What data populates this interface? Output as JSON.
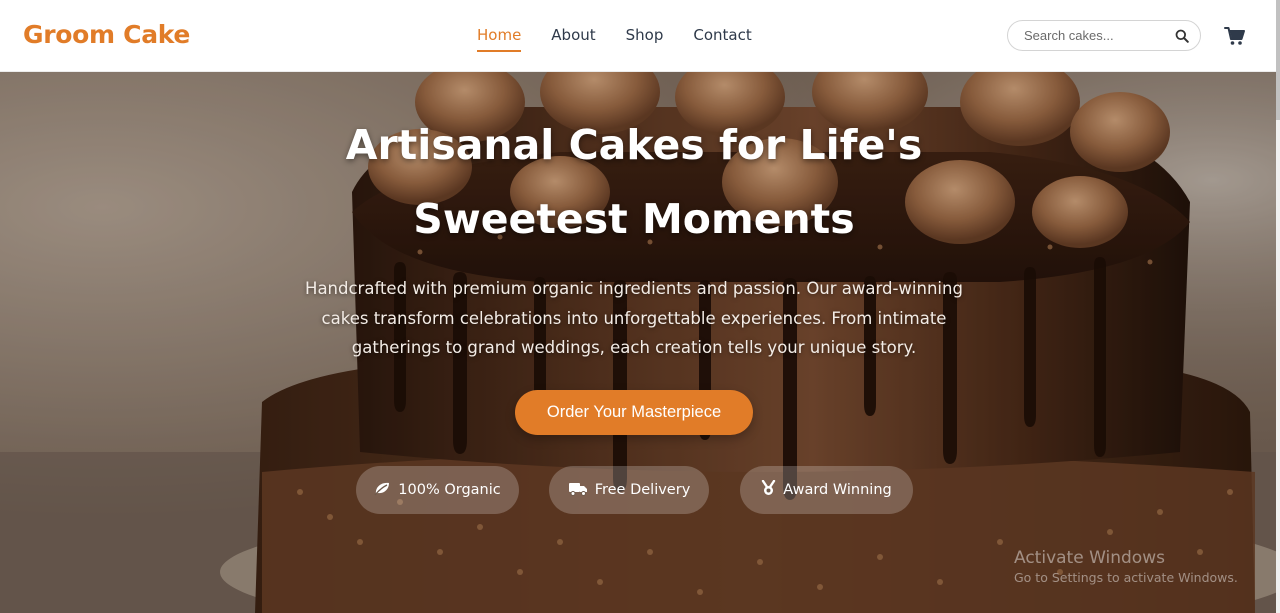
{
  "header": {
    "brand": "Groom Cake",
    "nav": [
      {
        "label": "Home",
        "active": true
      },
      {
        "label": "About",
        "active": false
      },
      {
        "label": "Shop",
        "active": false
      },
      {
        "label": "Contact",
        "active": false
      }
    ],
    "search": {
      "placeholder": "Search cakes...",
      "value": "",
      "icon": "search-icon"
    },
    "cart_icon": "cart-icon"
  },
  "hero": {
    "title_line1": "Artisanal Cakes for Life's",
    "title_line2": "Sweetest Moments",
    "description": "Handcrafted with premium organic ingredients and passion. Our award-winning cakes transform celebrations into unforgettable experiences. From intimate gatherings to grand weddings, each creation tells your unique story.",
    "cta_label": "Order Your Masterpiece",
    "badges": [
      {
        "label": "100% Organic",
        "icon": "leaf-icon"
      },
      {
        "label": "Free Delivery",
        "icon": "truck-icon"
      },
      {
        "label": "Award Winning",
        "icon": "medal-icon"
      }
    ]
  },
  "os_watermark": {
    "title": "Activate Windows",
    "subtitle": "Go to Settings to activate Windows."
  },
  "colors": {
    "accent": "#e17c28",
    "nav_text": "#2f3a4a",
    "hero_text": "#ffffff"
  }
}
